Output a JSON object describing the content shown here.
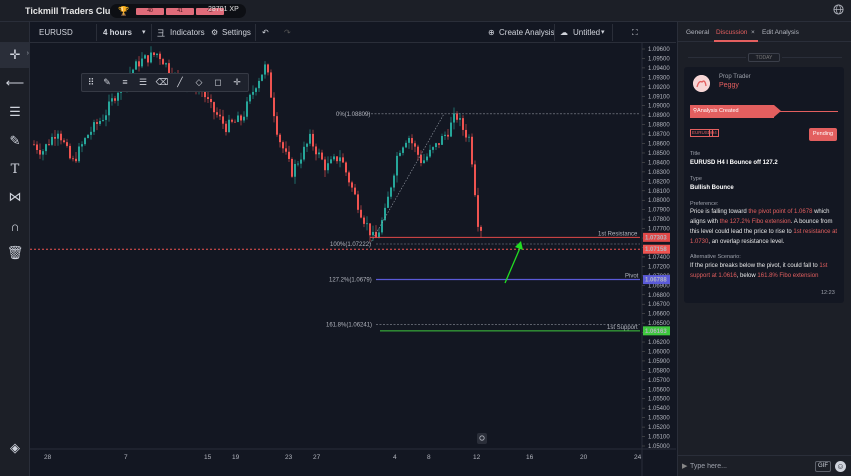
{
  "app": {
    "title": "Tickmill Traders Club",
    "xp_bars": [
      "40",
      "41",
      "42"
    ],
    "xp_text": "28701 XP"
  },
  "toolbar": {
    "symbol": "EURUSD",
    "interval": "4 hours",
    "indicators": "Indicators",
    "settings": "Settings",
    "create_analysis": "Create Analysis",
    "layout_name": "Untitled"
  },
  "left_tools": [
    "crosshair-icon",
    "horizontal-line-icon",
    "fib-levels-icon",
    "brush-icon",
    "text-icon",
    "pattern-icon",
    "magnet-icon",
    "trash-icon",
    "layers-icon"
  ],
  "drawing_tools": [
    "drag-handle-icon",
    "pencil-icon",
    "line-style-icon",
    "stroke-width-icon",
    "text-color-icon",
    "line-icon",
    "fill-icon",
    "rectangle-icon",
    "crosshair-icon"
  ],
  "chart": {
    "price_labels": [
      "1.09600",
      "1.09500",
      "1.09400",
      "1.09300",
      "1.09200",
      "1.09100",
      "1.09000",
      "1.08900",
      "1.08800",
      "1.08700",
      "1.08600",
      "1.08500",
      "1.08400",
      "1.08300",
      "1.08200",
      "1.08100",
      "1.08000",
      "1.07900",
      "1.07800",
      "1.07700",
      "1.07600",
      "1.07500",
      "1.07400",
      "1.07200",
      "1.07000",
      "1.06900",
      "1.06800",
      "1.06700",
      "1.06600",
      "1.06500",
      "1.06400",
      "1.06200",
      "1.06000",
      "1.05900",
      "1.05800",
      "1.05700",
      "1.05600",
      "1.05500",
      "1.05400",
      "1.05300",
      "1.05200",
      "1.05100",
      "1.05000"
    ],
    "time_labels": [
      "28",
      "7",
      "15",
      "19",
      "23",
      "27",
      "4",
      "8",
      "12",
      "16",
      "20",
      "24"
    ],
    "fib_levels": [
      {
        "label": "0%(1.08809)",
        "price": 1.08809
      },
      {
        "label": "100%(1.07222)",
        "price": 1.07222
      },
      {
        "label": "127.2%(1.0679)",
        "price": 1.0679
      },
      {
        "label": "161.8%(1.06241)",
        "price": 1.06241
      }
    ],
    "resistance": {
      "label": "1st Resistance",
      "price_tag": "1.07303",
      "price": 1.07303
    },
    "current_price": {
      "price_tag": "1.07158",
      "price": 1.07158
    },
    "pivot": {
      "label": "Pivot",
      "price_tag": "1.06788",
      "price": 1.06788
    },
    "support": {
      "label": "1st Support",
      "price_tag": "1.06163",
      "price": 1.06163
    },
    "colors": {
      "up": "#26a69a",
      "down": "#ef5350",
      "resistance": "#e04848",
      "pivot": "#5a5ad8",
      "support": "#3ec83e",
      "arrow": "#22dd22"
    }
  },
  "panel": {
    "tabs": [
      "General",
      "Discussion",
      "Edit Analysis"
    ],
    "tab_close": "×",
    "today": "TODAY",
    "author_role": "Prop Trader",
    "author_name": "Peggy",
    "event": "Analysis Created",
    "chips": [
      "EURUSD",
      "H4"
    ],
    "status": "Pending",
    "title_label": "Title",
    "title_value": "EURUSD H4 I Bounce off 127.2",
    "type_label": "Type",
    "type_value": "Bullish Bounce",
    "pref_label": "Preference:",
    "pref": {
      "t1": "Price is falling toward ",
      "h1": "the pivot point of 1.0678",
      "t2": " which aligns with ",
      "h2": "the 127.2% Fibo extension",
      "t3": ". A bounce from this level could lead the price to rise to ",
      "h3": "1st resistance at 1.0730",
      "t4": ", an overlap resistance level."
    },
    "alt_label": "Alternative Scenario:",
    "alt": {
      "t1": "If the price breaks below the pivot, it could fall to ",
      "h1": "1st support at 1.0616",
      "t2": ", below ",
      "h2": "161.8% Fibo extension"
    },
    "time": "12:23",
    "reply_placeholder": "Type here...",
    "gif": "GIF"
  }
}
